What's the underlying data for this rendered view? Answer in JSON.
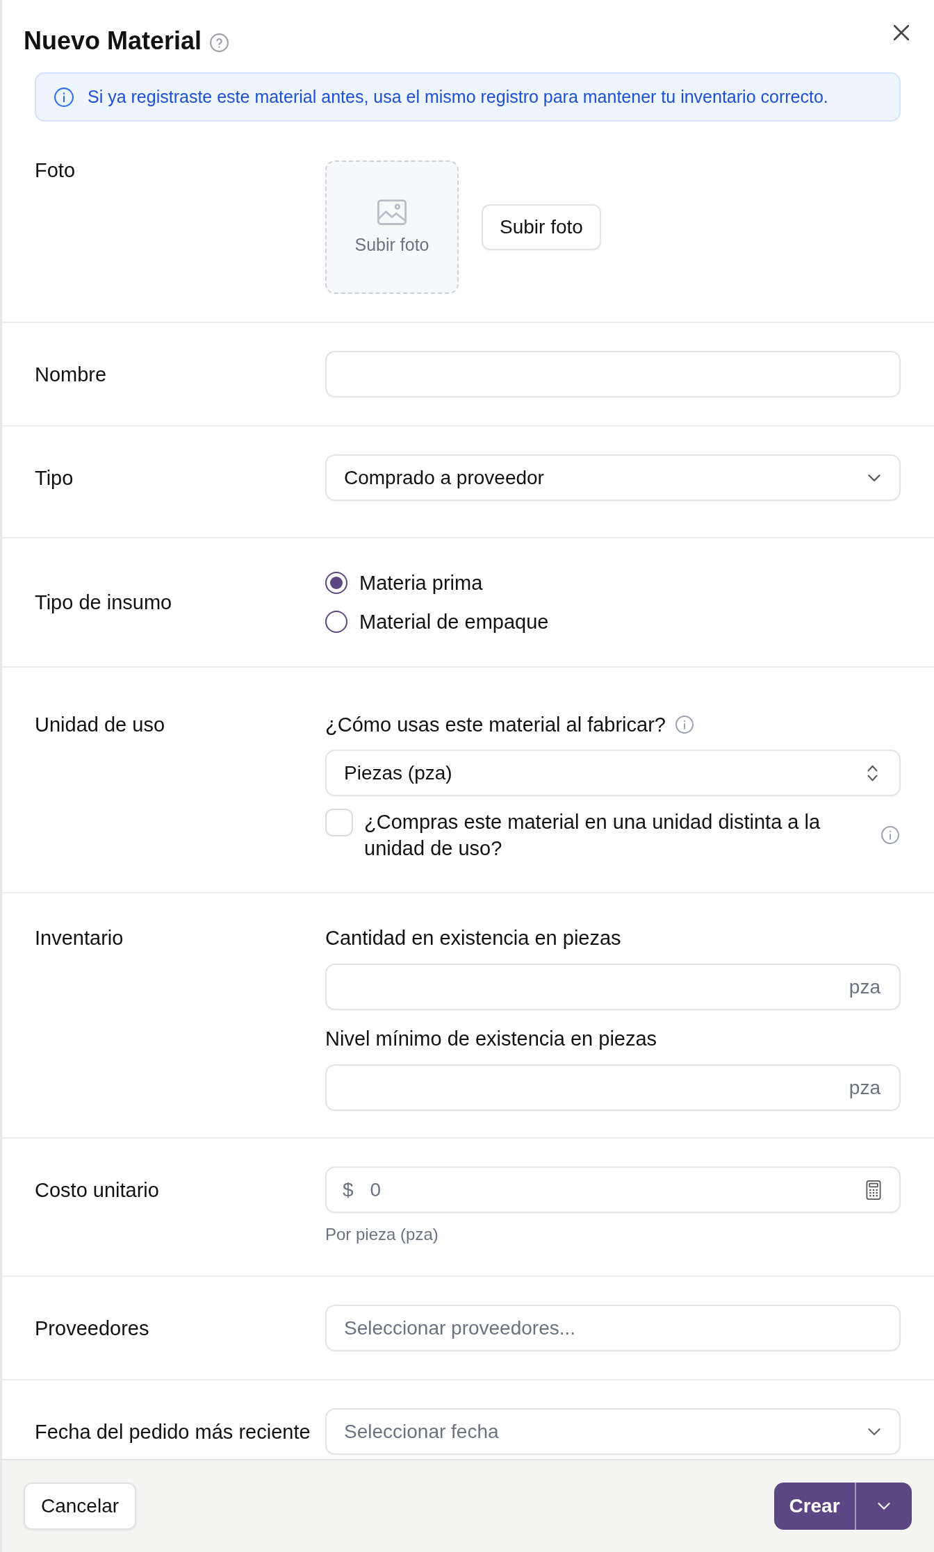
{
  "dialog": {
    "title": "Nuevo Material"
  },
  "notice": {
    "text": "Si ya registraste este material antes, usa el mismo registro para mantener tu inventario correcto."
  },
  "fields": [
    {
      "kind": "photo",
      "label": "Foto",
      "dropzone_text": "Subir foto",
      "button": "Subir foto"
    },
    {
      "kind": "text",
      "label": "Nombre"
    },
    {
      "kind": "select",
      "label": "Tipo",
      "value": "Comprado a proveedor"
    },
    {
      "kind": "radio",
      "label": "Tipo de insumo",
      "options": [
        {
          "label": "Materia prima",
          "selected": true
        },
        {
          "label": "Material de empaque",
          "selected": false
        }
      ]
    },
    {
      "kind": "unit",
      "label": "Unidad de uso",
      "question": "¿Cómo usas este material al fabricar?",
      "value": "Piezas (pza)",
      "checkbox": {
        "label": "¿Compras este material en una unidad distinta a la unidad de uso?",
        "checked": false
      }
    },
    {
      "kind": "inventory",
      "label": "Inventario",
      "inputs": [
        {
          "label": "Cantidad en existencia en piezas",
          "suffix": "pza"
        },
        {
          "label": "Nivel mínimo de existencia en piezas",
          "suffix": "pza"
        }
      ]
    },
    {
      "kind": "money",
      "label": "Costo unitario",
      "prefix": "$",
      "placeholder": "0",
      "hint": "Por pieza (pza)"
    },
    {
      "kind": "multiselect",
      "label": "Proveedores",
      "placeholder": "Seleccionar proveedores..."
    },
    {
      "kind": "date",
      "label": "Fecha del pedido más reciente",
      "placeholder": "Seleccionar fecha"
    }
  ],
  "footer": {
    "cancel_button": "Cancelar",
    "create_button": "Crear"
  }
}
